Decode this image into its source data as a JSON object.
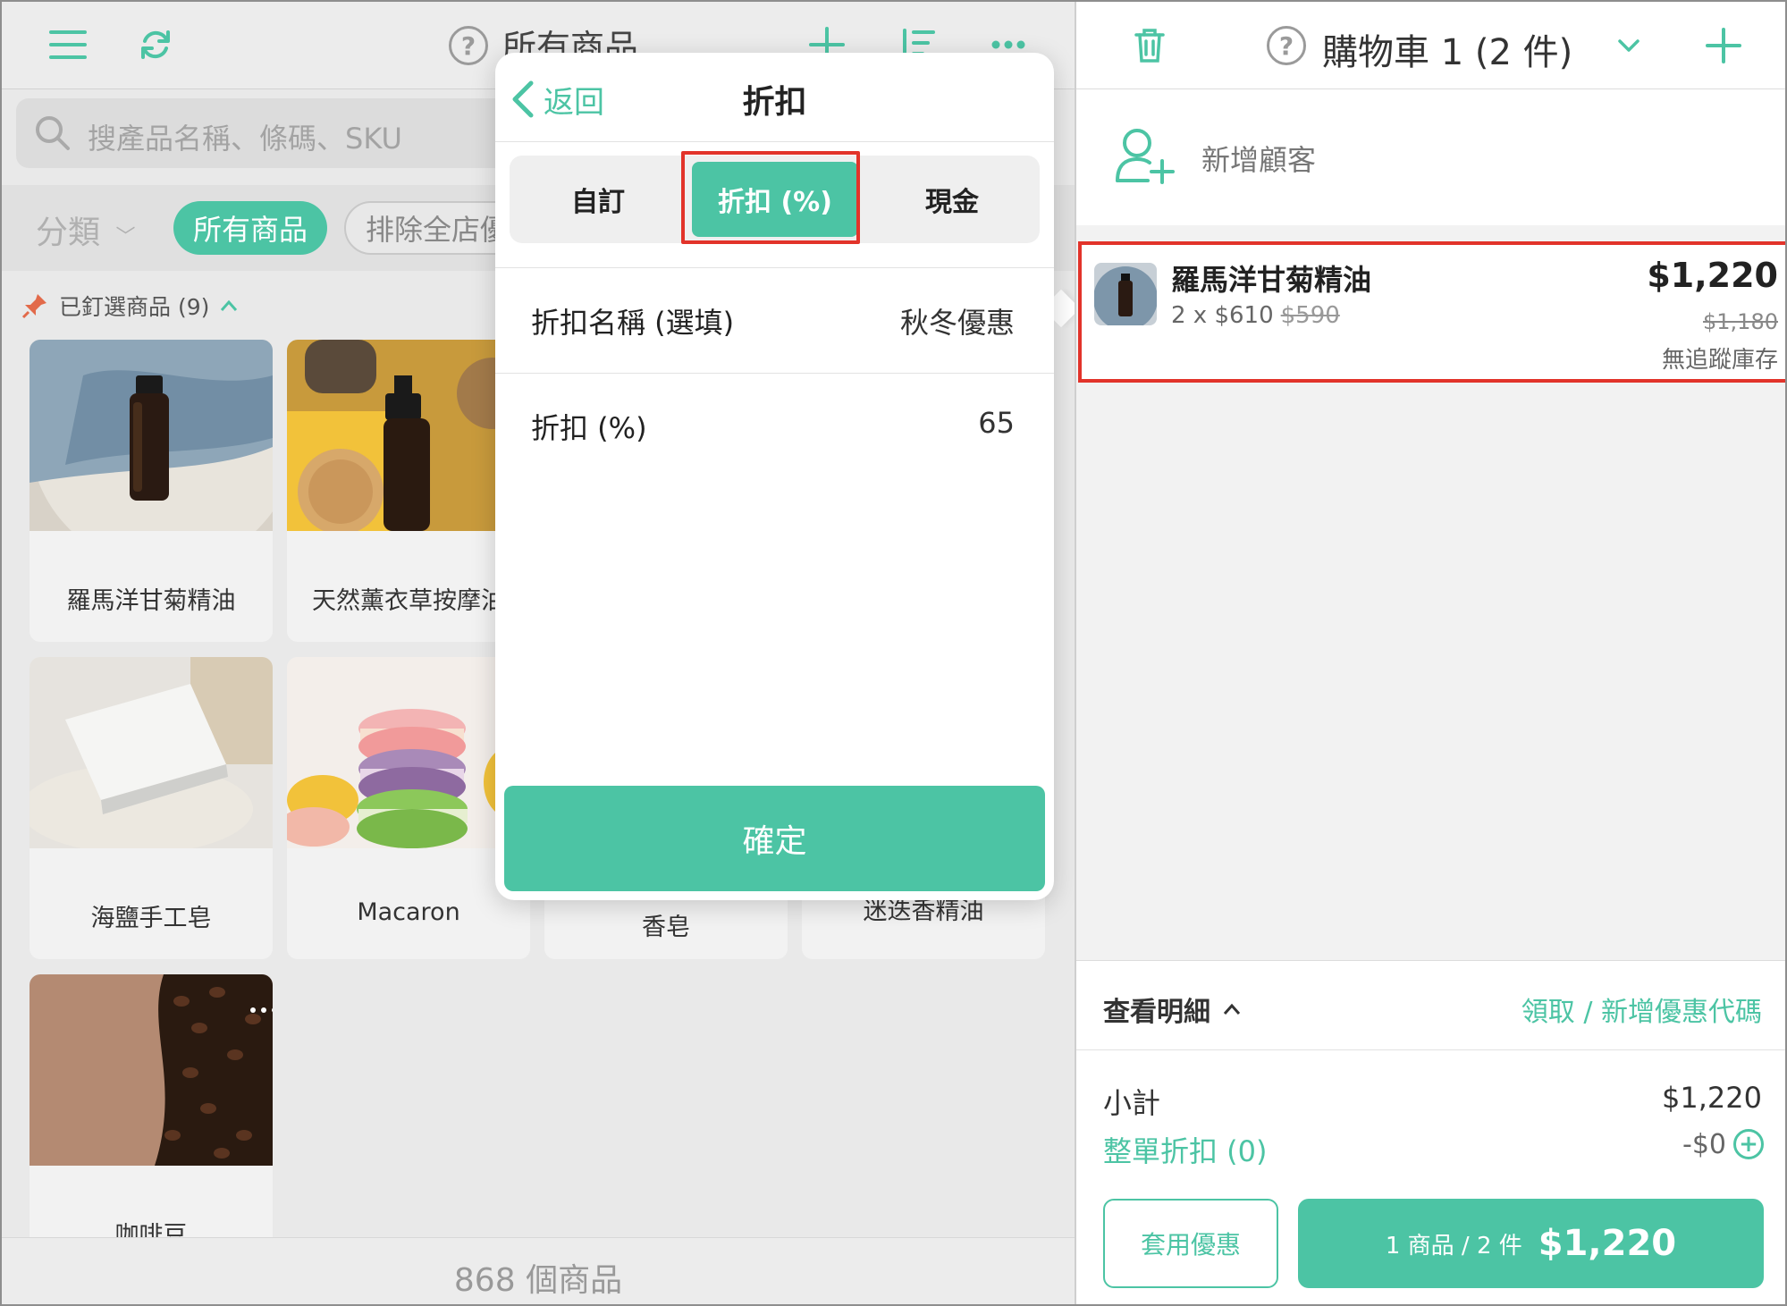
{
  "colors": {
    "accent": "#4cc4a4",
    "highlight": "#e2332a"
  },
  "products_panel": {
    "title": "所有商品",
    "search": {
      "placeholder": "搜產品名稱、條碼、SKU"
    },
    "category_label": "分類",
    "chips": {
      "all": "所有商品",
      "exclude": "排除全店優"
    },
    "pinned_label": "已釘選商品 (9)",
    "products": [
      {
        "name": "羅馬洋甘菊精油"
      },
      {
        "name": "天然薰衣草按摩油"
      },
      {
        "name": "海鹽手工皂"
      },
      {
        "name": "Macaron"
      },
      {
        "name": "香皂"
      },
      {
        "name": "迷迭香精油"
      },
      {
        "name": "咖啡豆"
      }
    ],
    "product_count": "868 個商品"
  },
  "popover": {
    "back_label": "返回",
    "title": "折扣",
    "tabs": {
      "custom": "自訂",
      "percent": "折扣 (%)",
      "cash": "現金"
    },
    "selected_tab": "percent",
    "name_field": {
      "label": "折扣名稱 (選填)",
      "value": "秋冬優惠"
    },
    "percent_field": {
      "label": "折扣 (%)",
      "value": "65"
    },
    "confirm_label": "確定"
  },
  "cart_panel": {
    "title": "購物車 1 (2 件)",
    "add_customer_label": "新增顧客",
    "item": {
      "name": "羅馬洋甘菊精油",
      "qty_price": "2 x $610",
      "original_unit_price": "$590",
      "total": "$1,220",
      "original_total": "$1,180",
      "stock_note": "無追蹤庫存"
    },
    "details_label": "查看明細",
    "coupon_link": "領取 / 新增優惠代碼",
    "subtotal_label": "小計",
    "subtotal_value": "$1,220",
    "order_discount_label": "整單折扣 (0)",
    "order_discount_value": "-$0",
    "apply_offer_label": "套用優惠",
    "checkout_summary": "1 商品 / 2 件",
    "checkout_total": "$1,220"
  }
}
